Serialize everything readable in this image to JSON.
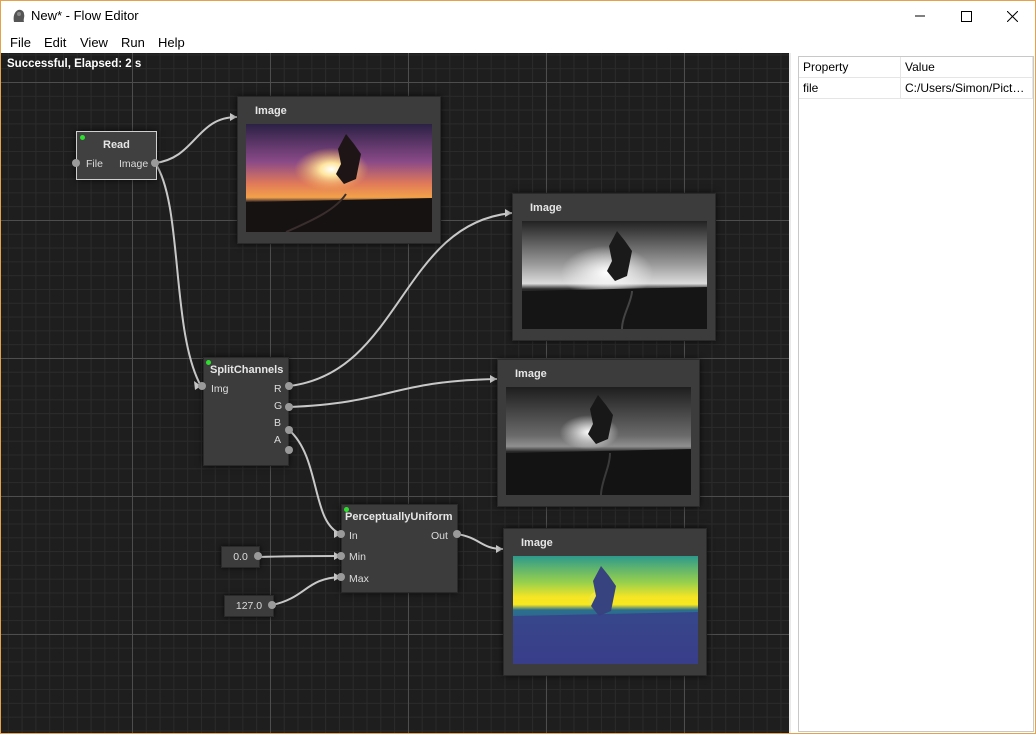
{
  "window": {
    "title": "New* - Flow Editor"
  },
  "menu": [
    "File",
    "Edit",
    "View",
    "Run",
    "Help"
  ],
  "status": "Successful, Elapsed: 2 s",
  "nodes": {
    "read": {
      "title": "Read",
      "input": "File",
      "output": "Image"
    },
    "split": {
      "title": "SplitChannels",
      "input": "Img",
      "outputs": [
        "R",
        "G",
        "B",
        "A"
      ]
    },
    "perceptual": {
      "title": "PerceptuallyUniform",
      "inputs": [
        "In",
        "Min",
        "Max"
      ],
      "output": "Out"
    },
    "min_value": "0.0",
    "max_value": "127.0",
    "image_1": {
      "title": "Image"
    },
    "image_2": {
      "title": "Image"
    },
    "image_3": {
      "title": "Image"
    },
    "image_4": {
      "title": "Image"
    }
  },
  "properties": {
    "headers": [
      "Property",
      "Value"
    ],
    "rows": [
      {
        "property": "file",
        "value": "C:/Users/Simon/Pictures/..."
      }
    ]
  },
  "colors": {
    "canvas": "#1e1e1e",
    "node": "#3c3c3c",
    "wire": "#c8c8c8",
    "led": "#2ee02e",
    "window_border": "#e6a24a"
  }
}
